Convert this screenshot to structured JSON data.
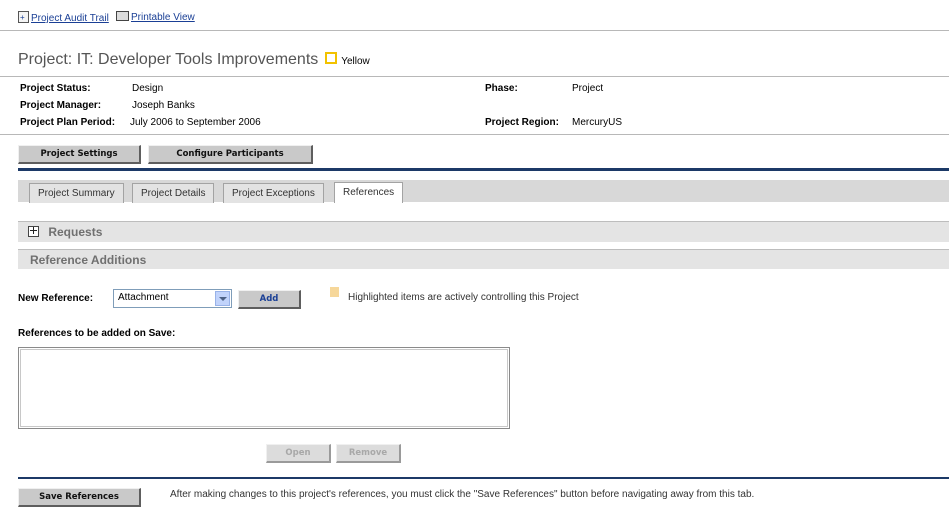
{
  "top_links": {
    "audit_trail": "Project Audit Trail",
    "printable_view": "Printable View"
  },
  "header": {
    "title": "Project: IT: Developer Tools Improvements",
    "status_color_label": "Yellow"
  },
  "fields": {
    "status_label": "Project Status:",
    "status_value": "Design",
    "phase_label": "Phase:",
    "phase_value": "Project",
    "manager_label": "Project Manager:",
    "manager_value": "Joseph Banks",
    "period_label": "Project Plan Period:",
    "period_value": "July 2006 to September 2006",
    "region_label": "Project Region:",
    "region_value": "MercuryUS"
  },
  "action_buttons": {
    "settings": "Project Settings",
    "participants": "Configure Participants"
  },
  "tabs": [
    "Project Summary",
    "Project Details",
    "Project Exceptions",
    "References"
  ],
  "sections": {
    "requests": "Requests",
    "additions": "Reference Additions"
  },
  "new_reference": {
    "label": "New Reference:",
    "selected": "Attachment",
    "add_button": "Add",
    "legend": "Highlighted items are actively controlling this Project"
  },
  "references_list": {
    "label": "References to be added on Save:",
    "open_button": "Open",
    "remove_button": "Remove"
  },
  "footer": {
    "save_button": "Save References",
    "note": "After making changes to this project's references, you must click the \"Save References\" button before navigating away from this tab."
  },
  "colors": {
    "status": "#f2c200",
    "link": "#1a3f95",
    "legend": "#f6d79a",
    "divider": "#1c3967"
  }
}
